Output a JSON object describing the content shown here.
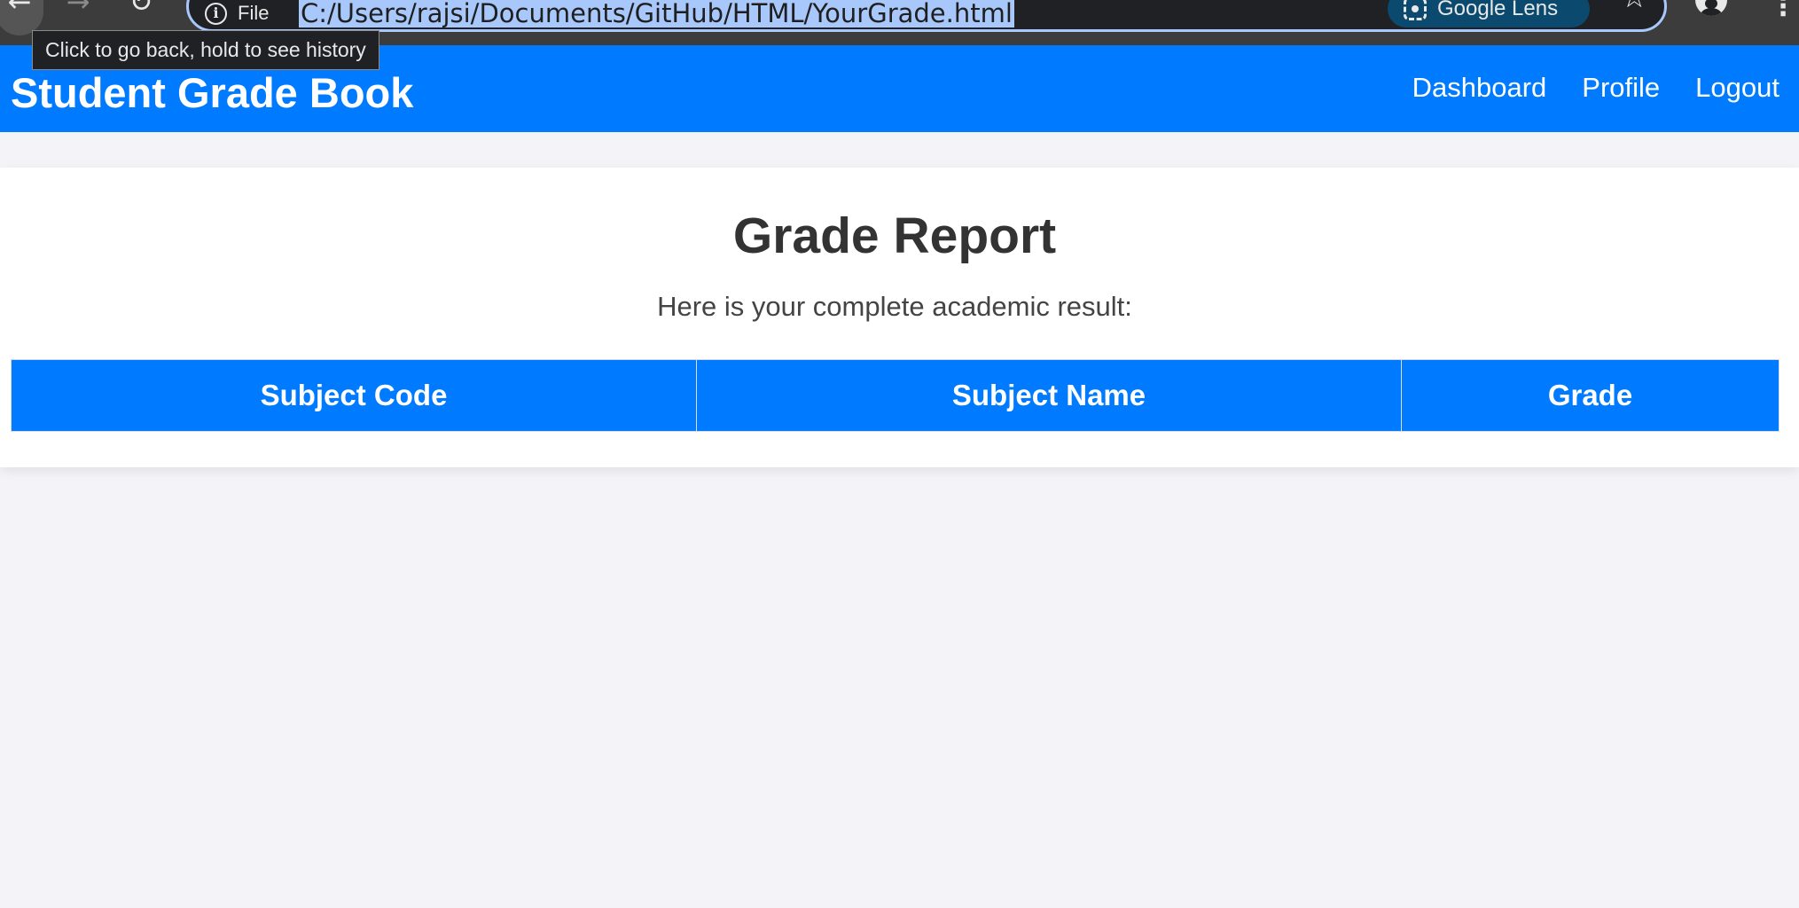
{
  "browser": {
    "site_info_label": "File",
    "url": "C:/Users/rajsi/Documents/GitHub/HTML/YourGrade.html",
    "lens_label": "Google Lens",
    "tooltip": "Click to go back, hold to see history"
  },
  "header": {
    "brand": "Student Grade Book",
    "nav": [
      "Dashboard",
      "Profile",
      "Logout"
    ]
  },
  "main": {
    "title": "Grade Report",
    "subtitle": "Here is your complete academic result:",
    "table": {
      "columns": [
        "Subject Code",
        "Subject Name",
        "Grade"
      ],
      "rows": []
    }
  },
  "colors": {
    "accent": "#007bff",
    "page_bg": "#f3f3f8",
    "chrome_bg": "#3c3c3c"
  }
}
